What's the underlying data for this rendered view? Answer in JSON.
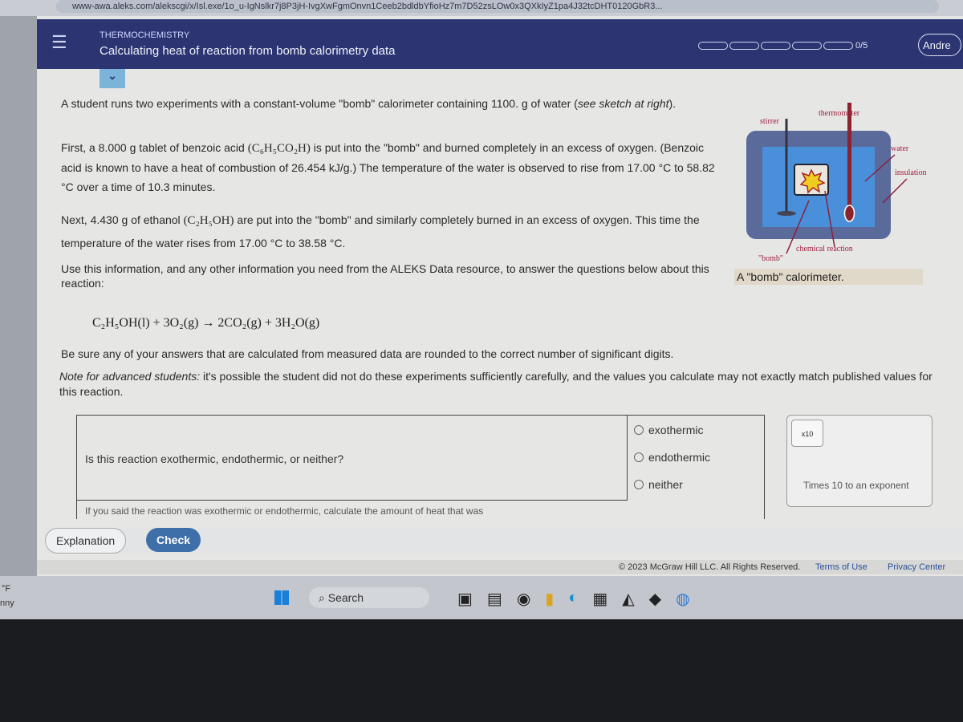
{
  "browser": {
    "url": "www-awa.aleks.com/alekscgi/x/Isl.exe/1o_u-IgNslkr7j8P3jH-IvgXwFgmOnvn1Ceeb2bdldbYfioHz7m7D52zsLOw0x3QXkIyZ1pa4J32tcDHT0120GbR3..."
  },
  "header": {
    "topic": "THERMOCHEMISTRY",
    "title": "Calculating heat of reaction from bomb calorimetry data",
    "progress_text": "0/5",
    "progress_value": 0,
    "progress_total": 5,
    "user": "Andre",
    "colors": {
      "header": "#2c3572",
      "accent": "#7cb4d9"
    }
  },
  "problem": {
    "intro": "A student runs two experiments with a constant-volume \"bomb\" calorimeter containing 1100. g of water (",
    "intro_italic": "see sketch at right",
    "intro_end": ").",
    "first_a": "First, a 8.000 g tablet of benzoic acid ",
    "benzoic": "(C₆H₅CO₂H)",
    "first_b": " is put into the \"bomb\" and burned completely in an excess of oxygen. (Benzoic acid is known to have a heat of combustion of 26.454 kJ/g.) The temperature of the water is observed to rise from 17.00 °C to 58.82 °C over a time of 10.3 minutes.",
    "next_a": "Next, 4.430 g of ethanol ",
    "ethanol": "(C₂H₅OH)",
    "next_b": " are put into the \"bomb\" and similarly completely burned in an excess of oxygen. This time the temperature of the water rises from 17.00 °C to 38.58 °C.",
    "use": "Use this information, and any other information you need from the ALEKS Data resource, to answer the questions below about this reaction:",
    "equation": "C₂H₅OH(l) + 3O₂(g) → 2CO₂(g) + 3H₂O(g)",
    "sigfigs": "Be sure any of your answers that are calculated from measured data are rounded to the correct number of significant digits.",
    "note_label": "Note for advanced students:",
    "note": " it's possible the student did not do these experiments sufficiently carefully, and the values you calculate may not exactly match published values for this reaction."
  },
  "diagram": {
    "labels": {
      "stirrer": "stirrer",
      "thermometer": "thermometer",
      "water": "water",
      "insulation": "insulation",
      "bomb": "\"bomb\"",
      "reaction": "chemical reaction"
    },
    "caption": "A \"bomb\" calorimeter."
  },
  "questions": [
    {
      "text": "Is this reaction exothermic, endothermic, or neither?",
      "options": [
        "exothermic",
        "endothermic",
        "neither"
      ]
    },
    {
      "text": "If you said the reaction was exothermic or endothermic, calculate the amount of heat that was"
    }
  ],
  "tool": {
    "button": "x10",
    "tooltip": "Times 10 to an exponent"
  },
  "buttons": {
    "explanation": "Explanation",
    "check": "Check"
  },
  "footer": {
    "copyright": "© 2023 McGraw Hill LLC. All Rights Reserved.",
    "terms": "Terms of Use",
    "privacy": "Privacy Center"
  },
  "taskbar": {
    "search": "Search",
    "weather_unit": "°F",
    "weather_text": "nny"
  }
}
